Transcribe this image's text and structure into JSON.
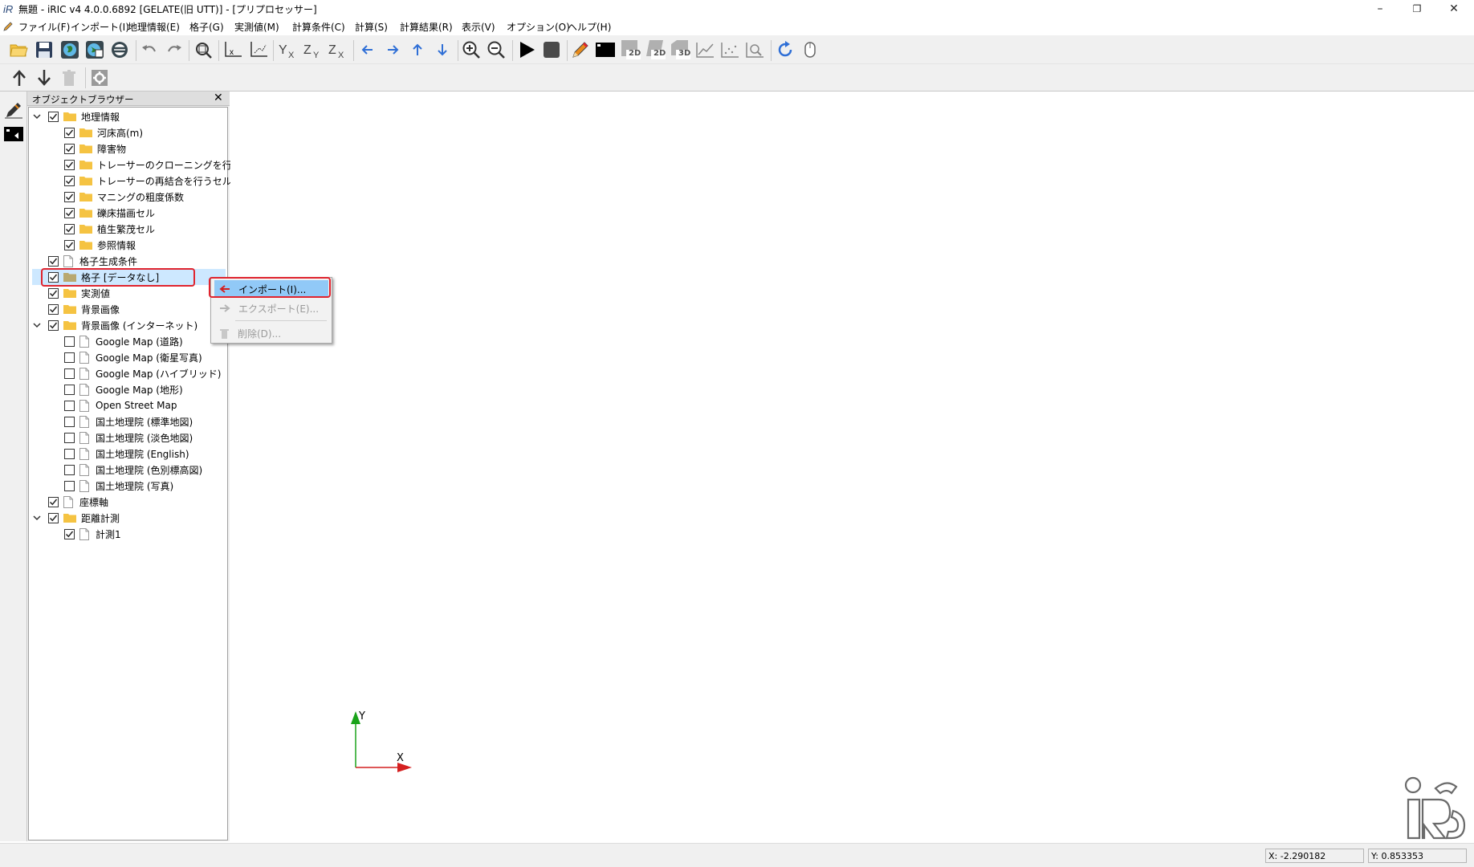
{
  "window": {
    "title": "無題 - iRIC v4 4.0.0.6892 [GELATE(旧 UTT)] - [プリプロセッサー]",
    "minimize": "–",
    "restore": "❐",
    "close": "✕"
  },
  "menubar": {
    "items": [
      "ファイル(F)",
      "インポート(I)",
      "地理情報(E)",
      "格子(G)",
      "実測値(M)",
      "計算条件(C)",
      "計算(S)",
      "計算結果(R)",
      "表示(V)",
      "オプション(O)",
      "ヘルプ(H)"
    ],
    "mdi": [
      "–",
      "❐",
      "✕"
    ]
  },
  "toolbar": {
    "icons": [
      "open-folder-icon",
      "save-icon",
      "world-icon",
      "world-edit-icon",
      "no-background-icon",
      "undo-icon",
      "redo-icon",
      "zoom-fit-icon",
      "x-axis-icon",
      "xy-axis-icon",
      "y-x-icon",
      "z-y-icon",
      "z-x-icon",
      "pan-left-icon",
      "pan-right-icon",
      "pan-up-icon",
      "pan-down-icon",
      "zoom-in-icon",
      "zoom-out-icon",
      "run-icon",
      "stop-icon",
      "pencil-icon",
      "console-icon",
      "2d-view-icon",
      "2d-bird-icon",
      "3d-view-icon",
      "graph-icon",
      "scatter-icon",
      "chart-zoom-icon",
      "refresh-icon",
      "mouse-icon"
    ],
    "labels2d": "2D",
    "label2db": "2D",
    "label3d": "3D"
  },
  "object_browser": {
    "title": "オブジェクトブラウザー",
    "close": "✕",
    "items": [
      {
        "label": "地理情報",
        "level": 0,
        "expanded": true,
        "checked": true,
        "icon": "folder"
      },
      {
        "label": "河床高(m)",
        "level": 1,
        "checked": true,
        "icon": "folder"
      },
      {
        "label": "障害物",
        "level": 1,
        "checked": true,
        "icon": "folder"
      },
      {
        "label": "トレーサーのクローニングを行うセル",
        "level": 1,
        "checked": true,
        "icon": "folder"
      },
      {
        "label": "トレーサーの再結合を行うセル",
        "level": 1,
        "checked": true,
        "icon": "folder"
      },
      {
        "label": "マニングの粗度係数",
        "level": 1,
        "checked": true,
        "icon": "folder"
      },
      {
        "label": "礫床描画セル",
        "level": 1,
        "checked": true,
        "icon": "folder"
      },
      {
        "label": "植生繁茂セル",
        "level": 1,
        "checked": true,
        "icon": "folder"
      },
      {
        "label": "参照情報",
        "level": 1,
        "checked": true,
        "icon": "folder"
      },
      {
        "label": "格子生成条件",
        "level": 0,
        "checked": true,
        "icon": "doc"
      },
      {
        "label": "格子 [データなし]",
        "level": 0,
        "checked": true,
        "icon": "folder",
        "selected": true
      },
      {
        "label": "実測値",
        "level": 0,
        "checked": true,
        "icon": "folder"
      },
      {
        "label": "背景画像",
        "level": 0,
        "checked": true,
        "icon": "folder"
      },
      {
        "label": "背景画像 (インターネット)",
        "level": 0,
        "expanded": true,
        "checked": true,
        "icon": "folder"
      },
      {
        "label": "Google Map (道路)",
        "level": 1,
        "checked": false,
        "icon": "doc"
      },
      {
        "label": "Google Map (衛星写真)",
        "level": 1,
        "checked": false,
        "icon": "doc"
      },
      {
        "label": "Google Map (ハイブリッド)",
        "level": 1,
        "checked": false,
        "icon": "doc"
      },
      {
        "label": "Google Map (地形)",
        "level": 1,
        "checked": false,
        "icon": "doc"
      },
      {
        "label": "Open Street Map",
        "level": 1,
        "checked": false,
        "icon": "doc"
      },
      {
        "label": "国土地理院 (標準地図)",
        "level": 1,
        "checked": false,
        "icon": "doc"
      },
      {
        "label": "国土地理院 (淡色地図)",
        "level": 1,
        "checked": false,
        "icon": "doc"
      },
      {
        "label": "国土地理院 (English)",
        "level": 1,
        "checked": false,
        "icon": "doc"
      },
      {
        "label": "国土地理院 (色別標高図)",
        "level": 1,
        "checked": false,
        "icon": "doc"
      },
      {
        "label": "国土地理院 (写真)",
        "level": 1,
        "checked": false,
        "icon": "doc"
      },
      {
        "label": "座標軸",
        "level": 0,
        "checked": true,
        "icon": "doc"
      },
      {
        "label": "距離計測",
        "level": 0,
        "expanded": true,
        "checked": true,
        "icon": "folder"
      },
      {
        "label": "計測1",
        "level": 1,
        "checked": true,
        "icon": "doc"
      }
    ]
  },
  "context_menu": {
    "import": "インポート(I)...",
    "export": "エクスポート(E)...",
    "delete": "削除(D)..."
  },
  "axes": {
    "y": "Y",
    "x": "X"
  },
  "status": {
    "x": "X: -2.290182",
    "y": "Y: 0.853353"
  },
  "colors": {
    "highlight": "#e0242e",
    "selection": "#cde8ff",
    "menu_hover": "#91c9f7",
    "folder": "#f5c342"
  }
}
